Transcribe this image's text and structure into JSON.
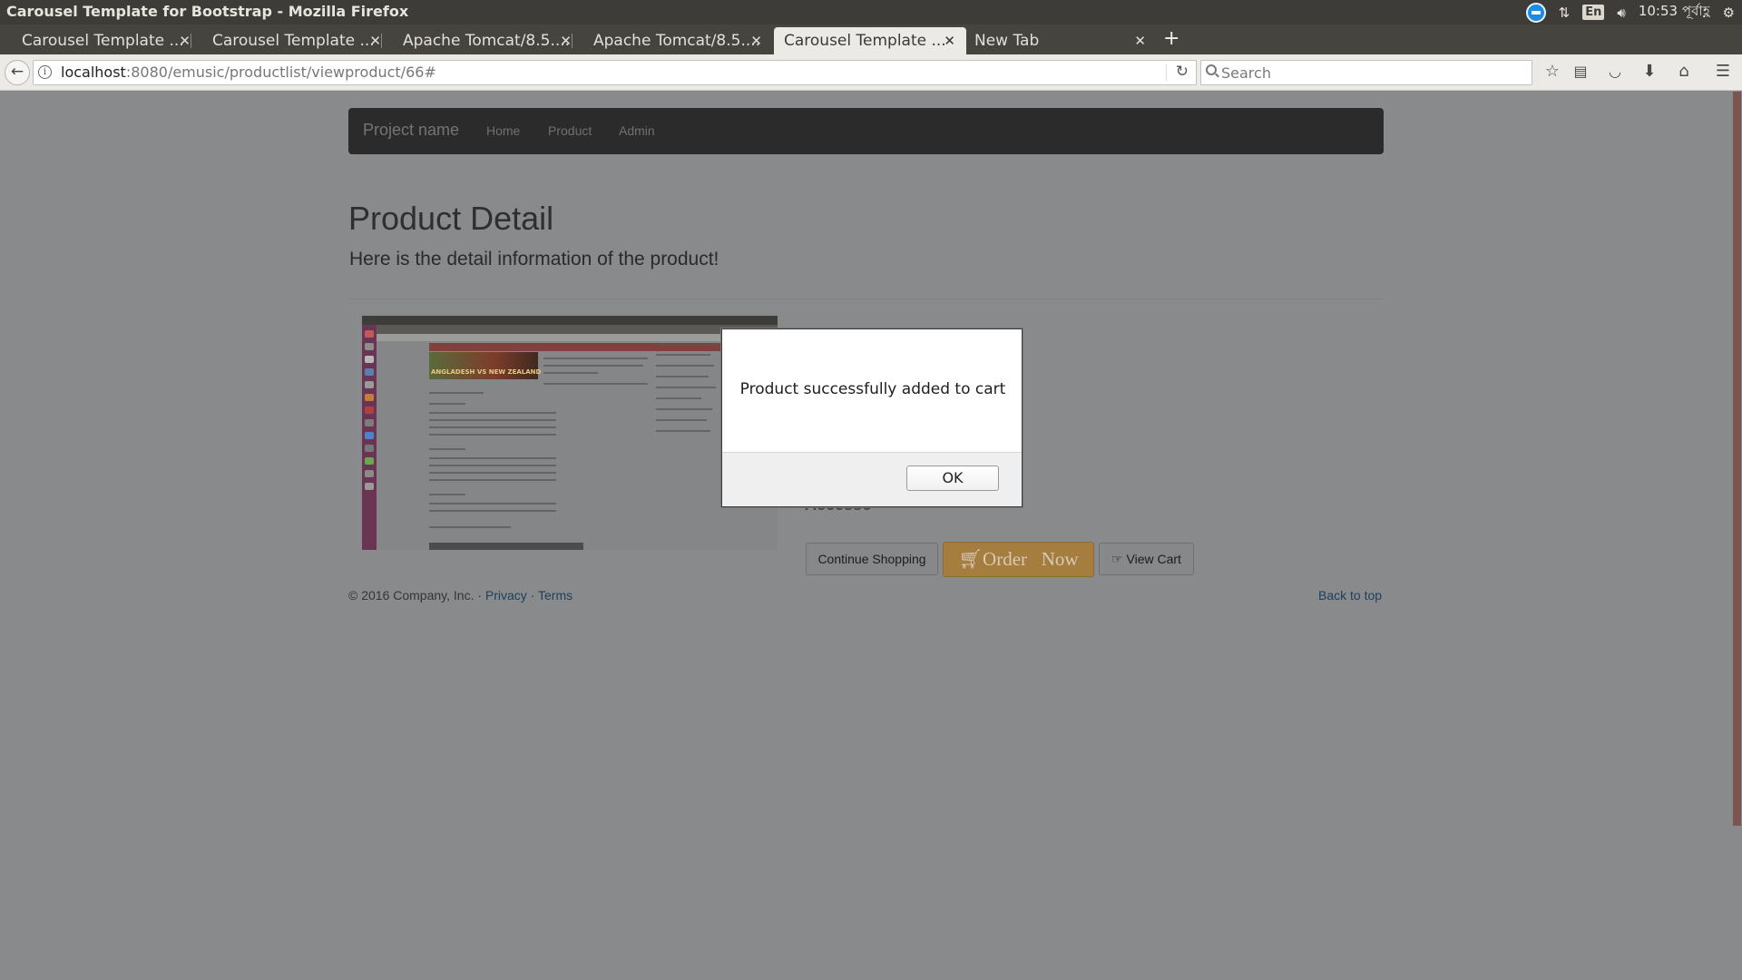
{
  "os": {
    "window_title": "Carousel Template for Bootstrap - Mozilla Firefox",
    "tray": {
      "lang": "En",
      "clock": "10:53 পূর্বাহ্ণ"
    }
  },
  "tabs": [
    {
      "label": "Carousel Template ..."
    },
    {
      "label": "Carousel Template ..."
    },
    {
      "label": "Apache Tomcat/8.5...."
    },
    {
      "label": "Apache Tomcat/8.5...."
    },
    {
      "label": "Carousel Template ..."
    },
    {
      "label": "New Tab"
    }
  ],
  "toolbar": {
    "url_host": "localhost",
    "url_rest": ":8080/emusic/productlist/viewproduct/66#",
    "search_placeholder": "Search"
  },
  "site": {
    "brand": "Project name",
    "nav": [
      "Home",
      "Product",
      "Admin"
    ],
    "title": "Product Detail",
    "lead": "Here is the detail information of the product!",
    "sub_text": "Accesso",
    "buttons": {
      "continue": "Continue Shopping",
      "order": "Order   Now",
      "view_cart": "View Cart"
    },
    "footer": {
      "copyright": "© 2016 Company, Inc. · ",
      "privacy": "Privacy",
      "dot": " · ",
      "terms": "Terms",
      "back_to_top": "Back to top"
    }
  },
  "dialog": {
    "message": "Product successfully added to cart",
    "ok_label": "OK"
  },
  "product_image": {
    "caption": "ANGLADESH VS NEW ZEALAND"
  },
  "colors": {
    "overlay_background": "#898a8c",
    "navbar": "#2b2b2c",
    "order_button": "#a57d3f",
    "scroll_thumb": "#7b5650"
  }
}
